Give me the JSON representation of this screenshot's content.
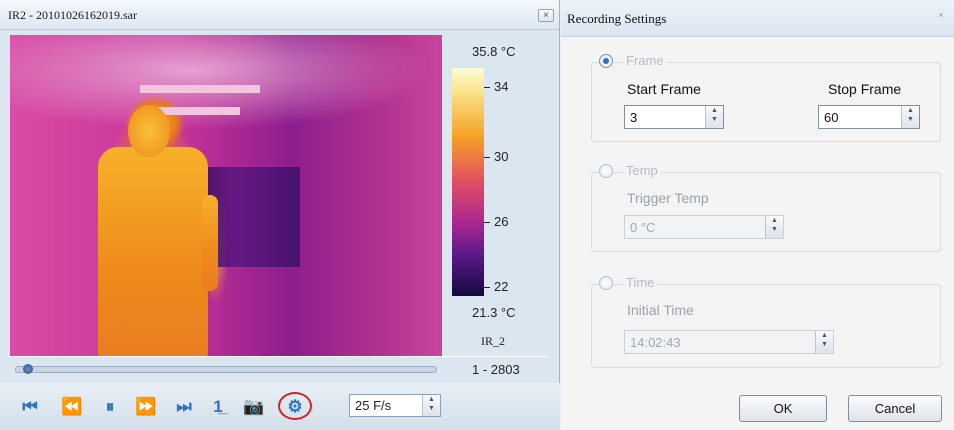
{
  "viewer": {
    "title": "IR2 - 20101026162019.sar",
    "close": "×",
    "scale": {
      "max": "35.8 °C",
      "min": "21.3 °C",
      "ticks": [
        "34",
        "30",
        "26",
        "22"
      ],
      "palette_name": "IR_2"
    },
    "frame_range": "1 - 2803",
    "playback_progress": 0.03,
    "toolbar": {
      "first": "⏮",
      "rewind": "⏪",
      "pause": "⏸",
      "forward": "⏩",
      "last": "⏭",
      "step": "1̲",
      "camera": "📷",
      "settings": "⚙",
      "fps": "25 F/s"
    }
  },
  "recording": {
    "title": "Recording Settings",
    "close": "×",
    "frame": {
      "label": "Frame",
      "start_label": "Start Frame",
      "start_value": "3",
      "stop_label": "Stop Frame",
      "stop_value": "60"
    },
    "temp": {
      "label": "Temp",
      "trigger_label": "Trigger Temp",
      "trigger_value": "0 °C"
    },
    "time": {
      "label": "Time",
      "initial_label": "Initial Time",
      "initial_value": "14:02:43"
    },
    "ok": "OK",
    "cancel": "Cancel"
  },
  "colors": {
    "accent": "#2f73c5",
    "highlight_circle": "#d62020"
  }
}
